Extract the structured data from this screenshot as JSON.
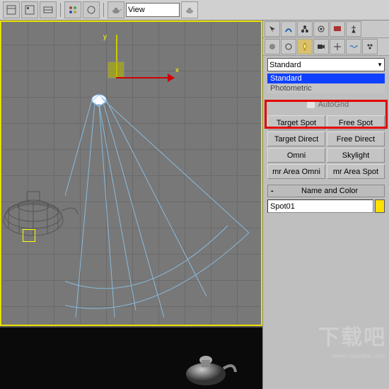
{
  "toolbar": {
    "view_label": "View"
  },
  "viewport": {
    "axis_x": "x",
    "axis_y": "y"
  },
  "panel": {
    "type_dd": "Standard",
    "opt_selected": "Standard",
    "opt_other": "Photometric",
    "autogrid": "AutoGrid",
    "buttons": {
      "target_spot": "Target Spot",
      "free_spot": "Free Spot",
      "target_direct": "Target Direct",
      "free_direct": "Free Direct",
      "omni": "Omni",
      "skylight": "Skylight",
      "mr_area_omni": "mr Area Omni",
      "mr_area_spot": "mr Area Spot"
    },
    "rollout": {
      "minus": "-",
      "title": "Name and Color"
    },
    "object_name": "Spot01"
  },
  "watermark": {
    "big": "下载吧",
    "url": "www.xiazaiba.com"
  }
}
